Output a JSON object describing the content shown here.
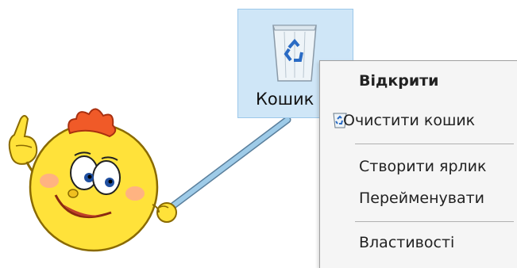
{
  "desktop": {
    "recycle_bin_label": "Кошик"
  },
  "context_menu": {
    "items": [
      {
        "label": "Відкрити",
        "bold": true
      },
      {
        "label": "Очистити кошик",
        "icon": "recycle-bin-icon"
      },
      {
        "label": "Створити ярлик"
      },
      {
        "label": "Перейменувати"
      },
      {
        "label": "Властивості"
      }
    ]
  },
  "colors": {
    "icon_selection": "#cfe6f7",
    "menu_background": "#f5f5f5",
    "pointer_stick": "#9ecbe8",
    "mascot_body": "#ffe23a",
    "mascot_hair": "#f05a28"
  }
}
